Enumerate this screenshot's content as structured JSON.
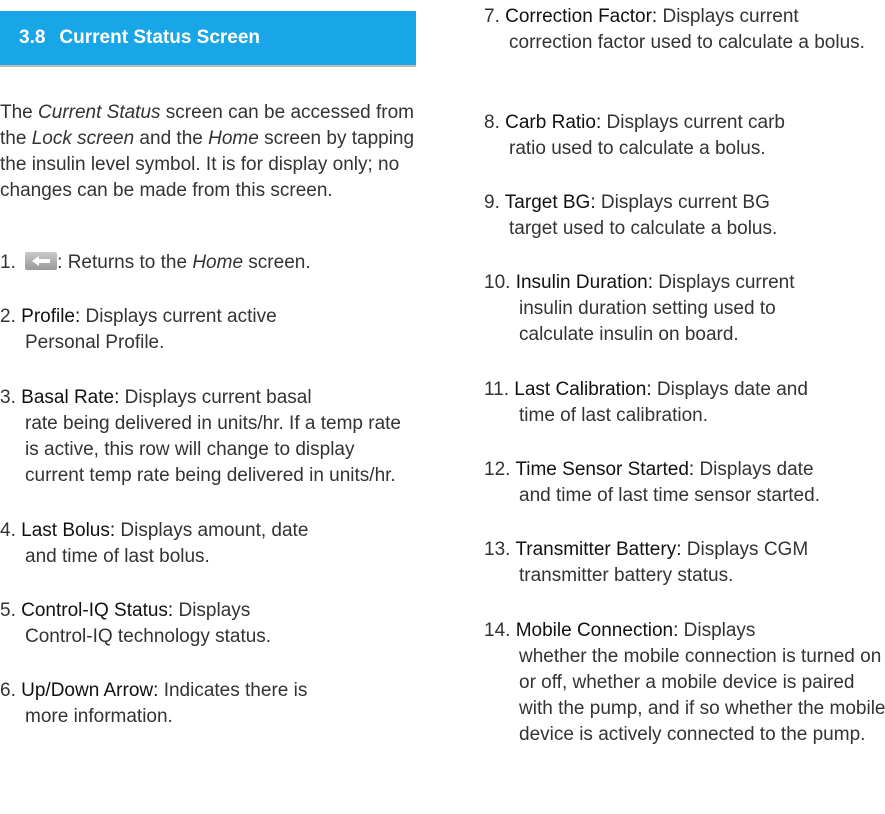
{
  "section": {
    "number": "3.8",
    "title": "Current Status Screen"
  },
  "intro": {
    "p1": "The ",
    "em1": "Current Status",
    "p2": " screen can be accessed from the ",
    "em2": "Lock screen",
    "p3": " and the ",
    "em3": "Home",
    "p4": " screen by tapping the insulin level symbol. It is for display only; no changes can be made from this screen."
  },
  "items": [
    {
      "num": "1.",
      "icon": "back-arrow-icon",
      "desc_pre": ": Returns to the ",
      "desc_em": "Home",
      "desc_post": " screen."
    },
    {
      "num": "2.",
      "term": "Profile:",
      "desc_first": " Displays current active",
      "desc_rest": "Personal Profile."
    },
    {
      "num": "3.",
      "term": "Basal Rate:",
      "desc_first": " Displays current basal",
      "desc_rest": "rate being delivered in units/hr. If a temp rate is active, this row will change to display current temp rate being delivered in units/hr."
    },
    {
      "num": "4.",
      "term": "Last Bolus:",
      "desc_first": " Displays amount, date",
      "desc_rest": "and time of last bolus."
    },
    {
      "num": "5.",
      "term": "Control-IQ Status:",
      "desc_first": " Displays",
      "desc_rest": "Control-IQ technology status."
    },
    {
      "num": "6.",
      "term": "Up/Down Arrow:",
      "desc_first": " Indicates there is",
      "desc_rest": "more information."
    },
    {
      "num": "7.",
      "term": "Correction Factor:",
      "desc_first": " Displays current",
      "desc_rest": "correction factor used to calculate a bolus."
    },
    {
      "num": "8.",
      "term": "Carb Ratio:",
      "desc_first": " Displays current carb",
      "desc_rest": "ratio used to calculate a bolus."
    },
    {
      "num": "9.",
      "term": "Target BG:",
      "desc_first": " Displays current BG",
      "desc_rest": "target used to calculate a bolus."
    },
    {
      "num": "10.",
      "term": "Insulin Duration:",
      "desc_first": " Displays current",
      "desc_rest": "insulin duration setting used to calculate insulin on board."
    },
    {
      "num": "11.",
      "term": "Last Calibration:",
      "desc_first": " Displays date and",
      "desc_rest": "time of last calibration."
    },
    {
      "num": "12.",
      "term": "Time Sensor Started:",
      "desc_first": " Displays date",
      "desc_rest": "and time of last time sensor started."
    },
    {
      "num": "13.",
      "term": "Transmitter Battery:",
      "desc_first": " Displays CGM",
      "desc_rest": "transmitter battery status."
    },
    {
      "num": "14.",
      "term": "Mobile Connection:",
      "desc_first": " Displays",
      "desc_rest": "whether the mobile connection is turned on or off, whether a mobile device is paired with the pump, and if so whether the mobile device is actively connected to the pump."
    }
  ]
}
